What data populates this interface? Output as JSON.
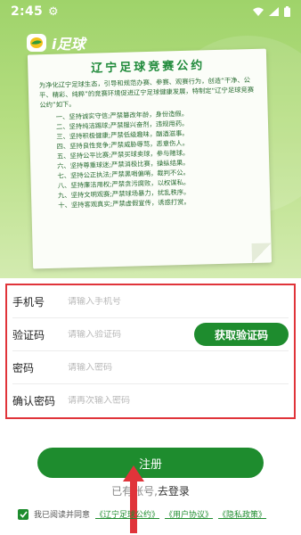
{
  "status_bar": {
    "time": "2:45"
  },
  "brand": {
    "name": "i足球"
  },
  "notice": {
    "title": "辽宁足球竞赛公约",
    "intro": "为净化辽宁足球生态，引导和规范办赛、参赛、观赛行为，创造“干净、公平、精彩、纯粹”的竞赛环境促进辽宁足球健康发展，特制定“辽宁足球竞赛公约”如下。",
    "items": [
      "一、坚持诚实守信;严禁篡改年龄，身份造假。",
      "二、坚持纯洁踢球;严禁服兴奋剂，违规用药。",
      "三、坚持积极健康;严禁低级趣味，酗酒滋事。",
      "四、坚持良性竞争;严禁威胁辱骂，恶意伤人。",
      "五、坚持公平比赛;严禁买球卖球，参与赌球。",
      "六、坚持尊重球迷;严禁消极比赛，操纵结果。",
      "七、坚持公正执法;严禁黑哨偏哨，裁判不公。",
      "八、坚持廉洁用权;严禁贪污腐败，以权谋私。",
      "九、坚持文明观赛;严禁球场暴力，扰乱秩序。",
      "十、坚持客观真实;严禁虚假宣传，诱惑打赏。"
    ]
  },
  "form": {
    "phone": {
      "label": "手机号",
      "placeholder": "请输入手机号"
    },
    "code": {
      "label": "验证码",
      "placeholder": "请输入验证码",
      "button": "获取验证码"
    },
    "password": {
      "label": "密码",
      "placeholder": "请输入密码"
    },
    "confirm": {
      "label": "确认密码",
      "placeholder": "请再次输入密码"
    }
  },
  "submit_label": "注册",
  "login": {
    "prefix": "已有账号,",
    "link": "去登录"
  },
  "agreement": {
    "checked": true,
    "prefix": "我已阅读并同意",
    "links": [
      "《辽宁足球公约》",
      "《用户协议》",
      "《隐私政策》"
    ]
  },
  "colors": {
    "accent": "#1e8c2e",
    "highlight_border": "#e0343a",
    "hero_green": "#9fd36a"
  }
}
